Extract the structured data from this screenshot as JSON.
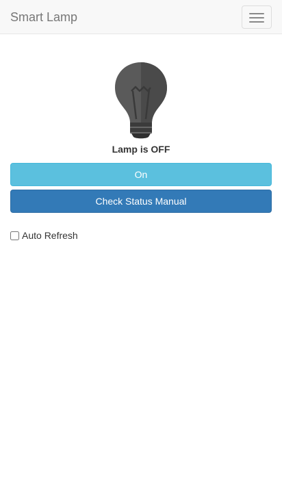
{
  "navbar": {
    "brand": "Smart Lamp",
    "menu_icon": "hamburger-menu-icon"
  },
  "lamp": {
    "icon": "light-bulb-icon",
    "state": "off",
    "status_text": "Lamp is OFF"
  },
  "controls": {
    "on_button_label": "On",
    "check_status_label": "Check Status Manual",
    "auto_refresh_label": "Auto Refresh",
    "auto_refresh_checked": false
  },
  "colors": {
    "on_button": "#5bc0de",
    "check_button": "#337ab7",
    "bulb_off": "#555555"
  }
}
